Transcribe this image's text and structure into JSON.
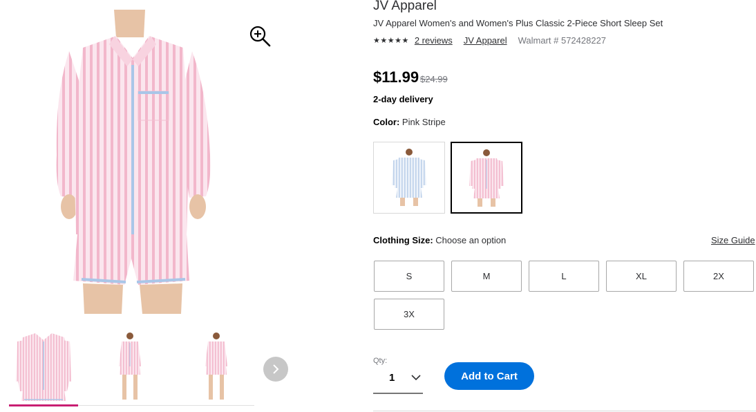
{
  "gallery": {
    "hero_image": "pink-stripe-sleep-set-front",
    "zoom_icon": "zoom-in-icon",
    "thumbnails": [
      {
        "icon": "pink-set-closeup-thumbnail",
        "active": true
      },
      {
        "icon": "pink-set-full-front-thumbnail",
        "active": false
      },
      {
        "icon": "pink-set-full-back-thumbnail",
        "active": false
      }
    ],
    "next_icon": "chevron-right-icon"
  },
  "product": {
    "brand": "JV Apparel",
    "title": "JV Apparel Women's and Women's Plus Classic 2-Piece Short Sleep Set",
    "stars": "★★★★★",
    "reviews": "2 reviews",
    "brand_link": "JV Apparel",
    "walmart_number": "Walmart # 572428227",
    "price": "$11.99",
    "was_price": "$24.99",
    "delivery": "2-day delivery"
  },
  "color": {
    "label": "Color:",
    "value": "Pink Stripe",
    "swatches": [
      {
        "name": "blue-stripe",
        "selected": false
      },
      {
        "name": "pink-stripe",
        "selected": true
      }
    ]
  },
  "size": {
    "label": "Clothing Size:",
    "value": "Choose an option",
    "guide": "Size Guide",
    "options": [
      "S",
      "M",
      "L",
      "XL",
      "2X",
      "3X"
    ]
  },
  "quantity": {
    "label": "Qty:",
    "value": "1",
    "chevron": "chevron-down-icon"
  },
  "cart": {
    "label": "Add to Cart",
    "color": "#0071dc"
  },
  "accent_colors": {
    "active_thumbnail": "#c81e72",
    "shirt": "#f5c9d8",
    "piping": "#a9c6e8"
  }
}
